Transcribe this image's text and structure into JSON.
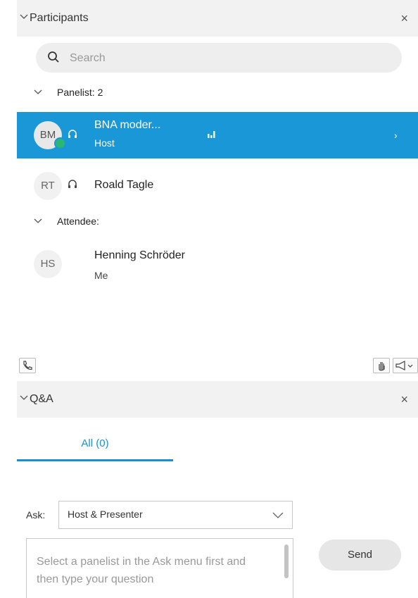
{
  "participants": {
    "title": "Participants",
    "close": "×",
    "search_placeholder": "Search",
    "groups": {
      "panelist": "Panelist: 2",
      "attendee": "Attendee:"
    },
    "panelists": [
      {
        "initials": "BM",
        "name": "BNA moder...",
        "role": "Host"
      },
      {
        "initials": "RT",
        "name": "Roald Tagle"
      }
    ],
    "attendees": [
      {
        "initials": "HS",
        "name": "Henning Schröder",
        "role": "Me"
      }
    ]
  },
  "qa": {
    "title": "Q&A",
    "close": "×",
    "tab_all": "All (0)",
    "ask_label": "Ask:",
    "ask_value": "Host & Presenter",
    "question_placeholder": "Select a panelist in the Ask menu first and then type your question",
    "send_label": "Send"
  },
  "colors": {
    "accent": "#1a97d6",
    "presence": "#2bb673"
  }
}
